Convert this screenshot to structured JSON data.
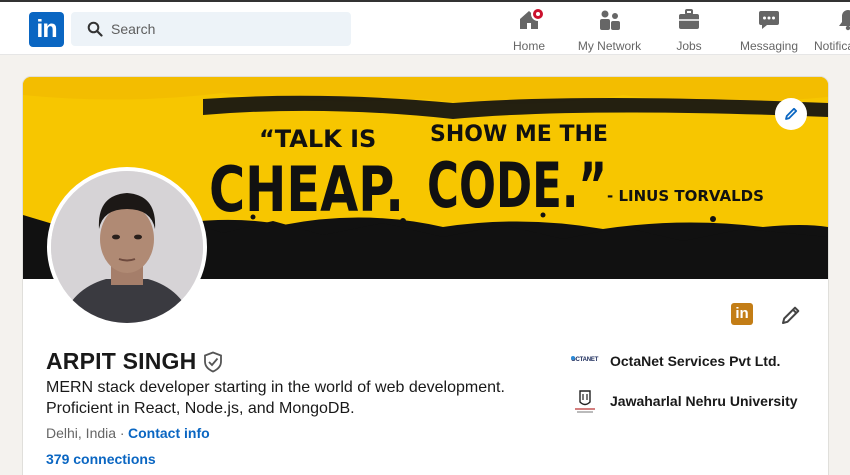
{
  "nav": {
    "logo": "in",
    "search_placeholder": "Search",
    "items": [
      {
        "label": "Home",
        "icon": "home-icon"
      },
      {
        "label": "My Network",
        "icon": "network-icon"
      },
      {
        "label": "Jobs",
        "icon": "briefcase-icon"
      },
      {
        "label": "Messaging",
        "icon": "messaging-icon"
      },
      {
        "label": "Notifications",
        "icon": "bell-icon"
      }
    ],
    "accent": "#0a66c2",
    "badge_color": "#cb112d"
  },
  "banner": {
    "quote_line1a": "“TALK IS",
    "quote_line1b": "SHOW ME THE",
    "quote_line2a": "CHEAP.",
    "quote_line2b": "CODE.”",
    "attribution": "- LINUS TORVALDS",
    "background": "#f7c600"
  },
  "profile": {
    "name": "ARPIT SINGH",
    "headline_line1": "MERN stack developer starting in the world of web development.",
    "headline_line2": "Proficient in React, Node.js, and MongoDB.",
    "location": "Delhi, India ·",
    "contact_link": "Contact info",
    "connections": "379 connections"
  },
  "experience": [
    {
      "name": "OctaNet Services Pvt Ltd.",
      "logo_text": "OCTANET"
    },
    {
      "name": "Jawaharlal Nehru University",
      "logo_text": "JNU"
    }
  ]
}
